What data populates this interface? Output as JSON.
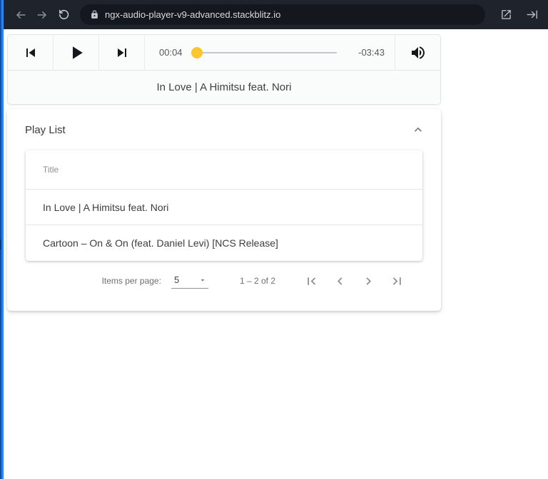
{
  "browser": {
    "url": "ngx-audio-player-v9-advanced.stackblitz.io"
  },
  "player": {
    "current_time": "00:04",
    "remaining_time": "-03:43",
    "progress_percent": 2,
    "track_title": "In Love | A Himitsu feat. Nori"
  },
  "playlist": {
    "title": "Play List",
    "column_header": "Title",
    "tracks": [
      "In Love | A Himitsu feat. Nori",
      "Cartoon – On & On (feat. Daniel Levi) [NCS Release]"
    ],
    "paginator": {
      "items_per_page_label": "Items per page:",
      "page_size": "5",
      "range_label": "1 – 2 of 2"
    }
  },
  "colors": {
    "accent": "#fdc62f",
    "browser_bar": "#1f232b",
    "url_pill": "#14171d",
    "resizer_blue": "#2b84f2"
  }
}
